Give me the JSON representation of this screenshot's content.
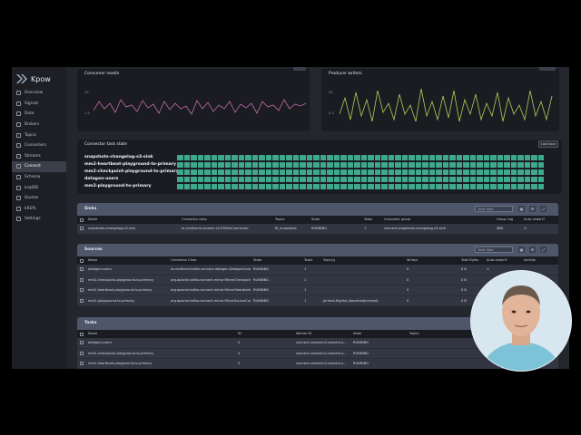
{
  "brand": {
    "name": "Kpow"
  },
  "nav": [
    {
      "label": "Overview",
      "icon": "dashboard-icon"
    },
    {
      "label": "Signals",
      "icon": "signal-icon"
    },
    {
      "label": "Data",
      "icon": "database-icon"
    },
    {
      "label": "Brokers",
      "icon": "server-icon"
    },
    {
      "label": "Topics",
      "icon": "list-icon"
    },
    {
      "label": "Consumers",
      "icon": "users-icon"
    },
    {
      "label": "Streams",
      "icon": "stream-icon"
    },
    {
      "label": "Connect",
      "icon": "plug-icon"
    },
    {
      "label": "Schema",
      "icon": "schema-icon"
    },
    {
      "label": "ksqlDB",
      "icon": "query-icon"
    },
    {
      "label": "Quotas",
      "icon": "quota-icon"
    },
    {
      "label": "kREPL",
      "icon": "terminal-icon"
    },
    {
      "label": "Settings",
      "icon": "gear-icon"
    }
  ],
  "active_nav": "Connect",
  "charts": {
    "consumer": {
      "title": "Consumer read/s",
      "y_top": "10",
      "y_bottom": "1.5"
    },
    "producer": {
      "title": "Producer write/s",
      "y_top": "20",
      "y_bottom": "0.3"
    }
  },
  "connector_task_state": {
    "title": "Connector task state",
    "button": "Last hour",
    "tasks": [
      "snapshots-changelog-s3-sink",
      "mm2-heartbeat-playground-to-primary",
      "mm2-checkpoint-playground-to-primary",
      "datagen-users",
      "mm2-playground-to-primary"
    ]
  },
  "sinks": {
    "title": "Sinks",
    "filter_placeholder": "Table filter",
    "columns": [
      "Name",
      "Connector class",
      "Topics",
      "State",
      "Tasks",
      "Consumer group",
      "Group Lag",
      "Auto-restart?"
    ],
    "rows": [
      [
        "snapshots-changelog-s3-sink",
        "io.confluent.connect.s3.S3SinkConnector",
        "flt_snapshots",
        "RUNNING",
        "1",
        "connect-snapshots-changelog-s3-sink",
        "488",
        "×"
      ]
    ]
  },
  "sources": {
    "title": "Sources",
    "filter_placeholder": "Table filter",
    "columns": [
      "Name",
      "Connector Class",
      "State",
      "Tasks",
      "Topic(s)",
      "Write/s",
      "Total Bytes",
      "Auto-restart?",
      "Activity"
    ],
    "rows": [
      [
        "datagen-users",
        "io.confluent.kafka.connect.datagen.DatagenConnector",
        "RUNNING",
        "1",
        "",
        "0",
        "0 B",
        "×",
        ""
      ],
      [
        "mm2-checkpoint-playground-to-primary",
        "org.apache.kafka.connect.mirror.MirrorCheckpointConnector",
        "RUNNING",
        "1",
        "",
        "0",
        "0 B",
        "",
        ""
      ],
      [
        "mm2-heartbeat-playground-to-primary",
        "org.apache.kafka.connect.mirror.MirrorHeartbeatConnector",
        "RUNNING",
        "1",
        "",
        "0",
        "0 B",
        "",
        ""
      ],
      [
        "mm2-playground-to-primary",
        "org.apache.kafka.connect.mirror.MirrorSourceConnector",
        "RUNNING",
        "1",
        "pirimot.flights\\.(departed|arrived)",
        "0",
        "0 B",
        "",
        ""
      ]
    ]
  },
  "tasks": {
    "title": "Tasks",
    "columns": [
      "Name",
      "ID",
      "Worker ID",
      "State",
      "Topics"
    ],
    "rows": [
      [
        "datagen-users",
        "0",
        "connect-connect-0.connect-s...",
        "RUNNING",
        ""
      ],
      [
        "mm2-checkpoint-playground-to-primary",
        "0",
        "connect-connect-0.connect-s...",
        "RUNNING",
        ""
      ],
      [
        "mm2-heartbeat-playground-to-primary",
        "0",
        "connect-connect-0.connect-s...",
        "RUNNING",
        ""
      ]
    ]
  }
}
